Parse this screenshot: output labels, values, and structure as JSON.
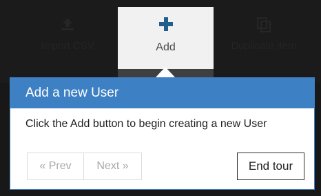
{
  "toolbar": {
    "import_label": "Import CSV",
    "import_icon": "upload-icon",
    "add_label": "Add",
    "add_icon": "plus-icon",
    "duplicate_label": "Duplicate item",
    "duplicate_icon": "duplicate-icon"
  },
  "tour": {
    "title": "Add a new User",
    "body": "Click the Add button to begin creating a new User",
    "prev_label": "« Prev",
    "next_label": "Next »",
    "end_label": "End tour"
  },
  "colors": {
    "accent": "#3e80c4",
    "icon_blue": "#1e5f8e",
    "toolbar_dark": "#1b1b1b"
  }
}
